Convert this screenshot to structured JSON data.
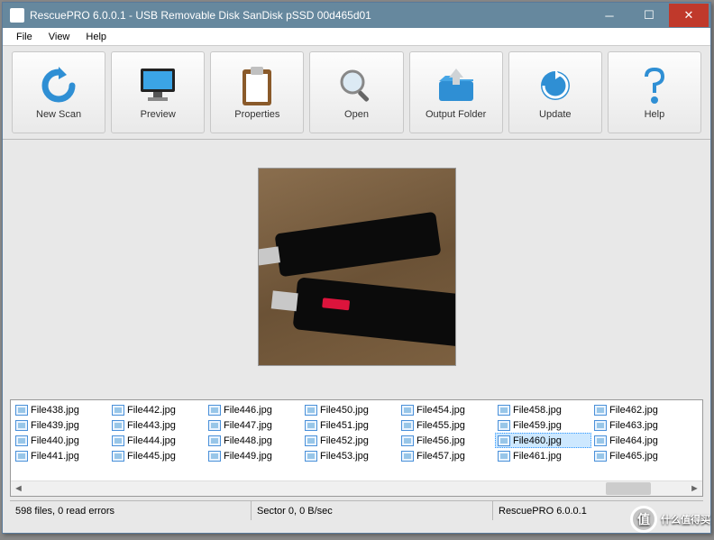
{
  "title": "RescuePRO 6.0.0.1 - USB Removable Disk SanDisk pSSD 00d465d01",
  "menu": {
    "file": "File",
    "view": "View",
    "help": "Help"
  },
  "toolbar": {
    "newscan": "New Scan",
    "preview": "Preview",
    "properties": "Properties",
    "open": "Open",
    "outputfolder": "Output Folder",
    "update": "Update",
    "help": "Help"
  },
  "files": [
    "File438.jpg",
    "File439.jpg",
    "File440.jpg",
    "File441.jpg",
    "File442.jpg",
    "File443.jpg",
    "File444.jpg",
    "File445.jpg",
    "File446.jpg",
    "File447.jpg",
    "File448.jpg",
    "File449.jpg",
    "File450.jpg",
    "File451.jpg",
    "File452.jpg",
    "File453.jpg",
    "File454.jpg",
    "File455.jpg",
    "File456.jpg",
    "File457.jpg",
    "File458.jpg",
    "File459.jpg",
    "File460.jpg",
    "File461.jpg",
    "File462.jpg",
    "File463.jpg",
    "File464.jpg",
    "File465.jpg"
  ],
  "selected": "File460.jpg",
  "status": {
    "left": "598 files, 0 read errors",
    "mid": "Sector 0, 0 B/sec",
    "right": "RescuePRO 6.0.0.1"
  },
  "watermark": "什么值得买"
}
